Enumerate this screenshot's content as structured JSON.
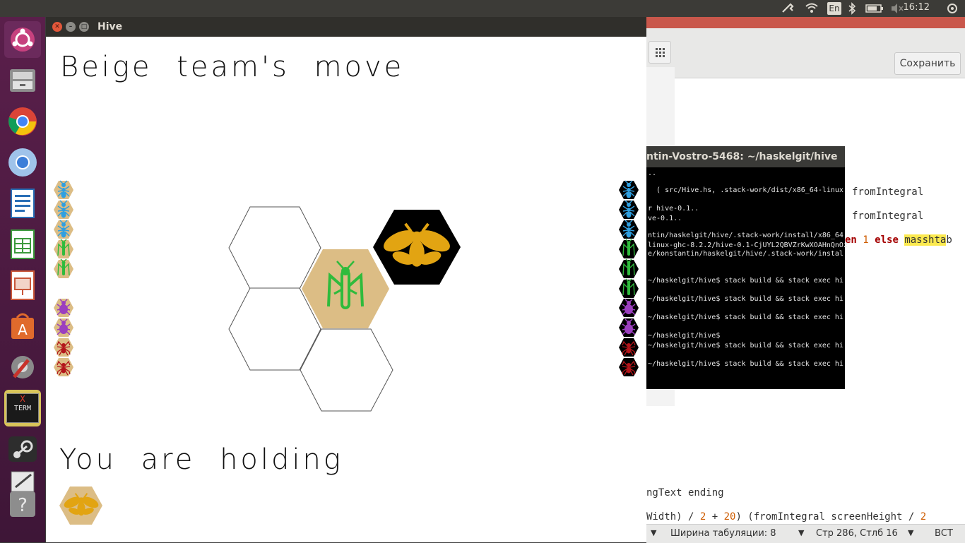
{
  "top_panel": {
    "keyboard_layout": "En",
    "clock": "16:12",
    "icons": [
      "network-tool-icon",
      "wifi-icon",
      "keyboard-icon",
      "bluetooth-icon",
      "battery-icon",
      "volume-muted-icon",
      "settings-icon"
    ]
  },
  "launcher": {
    "items": [
      {
        "name": "ubuntu-dash-icon",
        "color": "#dd4814"
      },
      {
        "name": "files-icon",
        "color": "#b28a5c"
      },
      {
        "name": "chrome-icon",
        "color": "#db4437"
      },
      {
        "name": "chromium-icon",
        "color": "#4a8fdb"
      },
      {
        "name": "libreoffice-writer-icon",
        "color": "#2a6fb6"
      },
      {
        "name": "libreoffice-calc-icon",
        "color": "#3d9a3d"
      },
      {
        "name": "libreoffice-impress-icon",
        "color": "#c9573a"
      },
      {
        "name": "software-center-icon",
        "color": "#e06a2c"
      },
      {
        "name": "system-settings-icon",
        "color": "#8a8a8a"
      },
      {
        "name": "xterm-icon",
        "color": "#d8c45a"
      },
      {
        "name": "steam-icon",
        "color": "#3a3a3a"
      },
      {
        "name": "text-editor-icon",
        "color": "#888888"
      },
      {
        "name": "help-icon",
        "color": "#9a9a9a"
      }
    ],
    "xterm_label_top": "X",
    "xterm_label_bottom": "TERM"
  },
  "hive_window": {
    "title": "Hive",
    "status_heading": "Beige team's move",
    "holding_heading": "You are holding",
    "colors": {
      "beige": "#dcbd85",
      "black": "#000000",
      "gold": "#e2a412",
      "green": "#2fbb3c",
      "blue": "#2f9fe0",
      "purple": "#9b3fbf",
      "red": "#b3161b"
    }
  },
  "terminal": {
    "title": "ntin-Vostro-5468: ~/haskelgit/hive",
    "lines": [
      "..",
      "  ( src/Hive.hs, .stack-work/dist/x86_64-linux",
      "",
      "r hive-0.1..",
      "ve-0.1..",
      "",
      "ntin/haskelgit/hive/.stack-work/install/x86_64",
      "linux-ghc-8.2.2/hive-0.1-CjUYL2QBVZrKwXOAHnQnOz",
      "e/konstantin/haskelgit/hive/.stack-work/instal",
      "",
      "",
      "~/haskelgit/hive$ stack build && stack exec hi",
      "",
      "~/haskelgit/hive$ stack build && stack exec hi",
      "",
      "~/haskelgit/hive$ stack build && stack exec hi",
      "",
      "~/haskelgit/hive$",
      "~/haskelgit/hive$ stack build && stack exec hi",
      "",
      "~/haskelgit/hive$ stack build && stack exec hi"
    ]
  },
  "editor": {
    "save_label": "Сохранить",
    "code_lines": {
      "l1": "fromIntegral",
      "l2": "fromIntegral",
      "l3_a": "en",
      "l3_b": "1",
      "l3_c": "else",
      "l3_d": "masshta",
      "l3_e": "b",
      "l4": "ngText ending",
      "l5_a": "Width) / ",
      "l5_b": "2",
      "l5_c": " + ",
      "l5_d": "20",
      "l5_e": ") (fromIntegral screenHeight / ",
      "l5_f": "2"
    },
    "status": {
      "tab_width": "Ширина табуляции: 8",
      "position": "Стр 286, Стлб 16",
      "mode": "ВСТ"
    }
  }
}
